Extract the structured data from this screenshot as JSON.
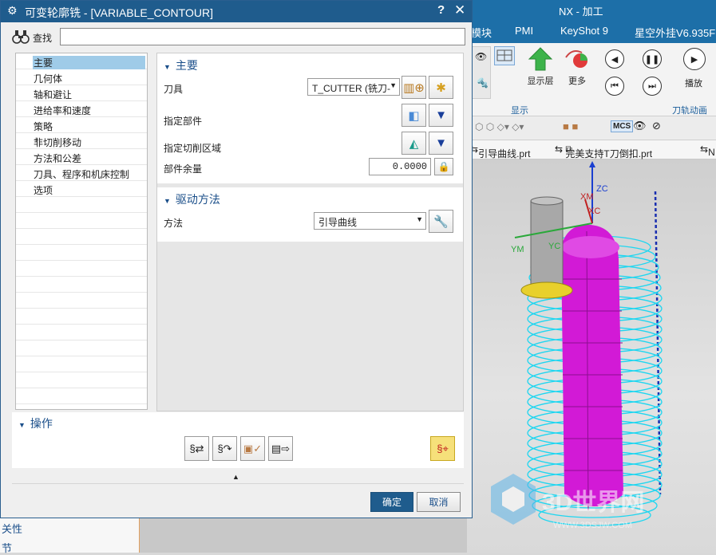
{
  "nx": {
    "title": "NX - 加工",
    "menu": [
      "模块",
      "PMI",
      "KeyShot 9",
      "星空外挂V6.935F"
    ],
    "ribbon": {
      "btn_show_layer": "显示层",
      "btn_more": "更多",
      "btn_play": "播放",
      "group_display": "显示",
      "group_path_anim": "刀轨动画"
    },
    "toolbar_mcs": "MCS",
    "tabs": [
      "引导曲线.prt",
      "完美支持T刀倒扣.prt",
      "N"
    ],
    "axis": {
      "zc": "ZC",
      "xm": "XM",
      "xc": "XC",
      "ym": "YM",
      "yc": "YC"
    },
    "watermark": {
      "text": "3D世界网",
      "url": "WWW.3DSJW.COM"
    },
    "left_items": [
      "关性",
      "节"
    ]
  },
  "dialog": {
    "title": "可变轮廓铣 - [VARIABLE_CONTOUR]",
    "help": "?",
    "close": "✕",
    "find_label": "查找",
    "find_value": "",
    "tree": [
      {
        "label": "主要",
        "selected": true
      },
      {
        "label": "几何体"
      },
      {
        "label": "轴和避让"
      },
      {
        "label": "进给率和速度"
      },
      {
        "label": "策略"
      },
      {
        "label": "非切削移动",
        "expandable": true
      },
      {
        "label": "方法和公差"
      },
      {
        "label": "刀具、程序和机床控制"
      },
      {
        "label": "选项"
      }
    ],
    "main": {
      "header": "主要",
      "tool_label": "刀具",
      "tool_value": "T_CUTTER (铣刀-",
      "part_label": "指定部件",
      "cut_area_label": "指定切削区域",
      "stock_label": "部件余量",
      "stock_value": "0.0000"
    },
    "drive": {
      "header": "驱动方法",
      "method_label": "方法",
      "method_value": "引导曲线"
    },
    "operations": {
      "header": "操作"
    },
    "ok": "确定",
    "cancel": "取消"
  }
}
